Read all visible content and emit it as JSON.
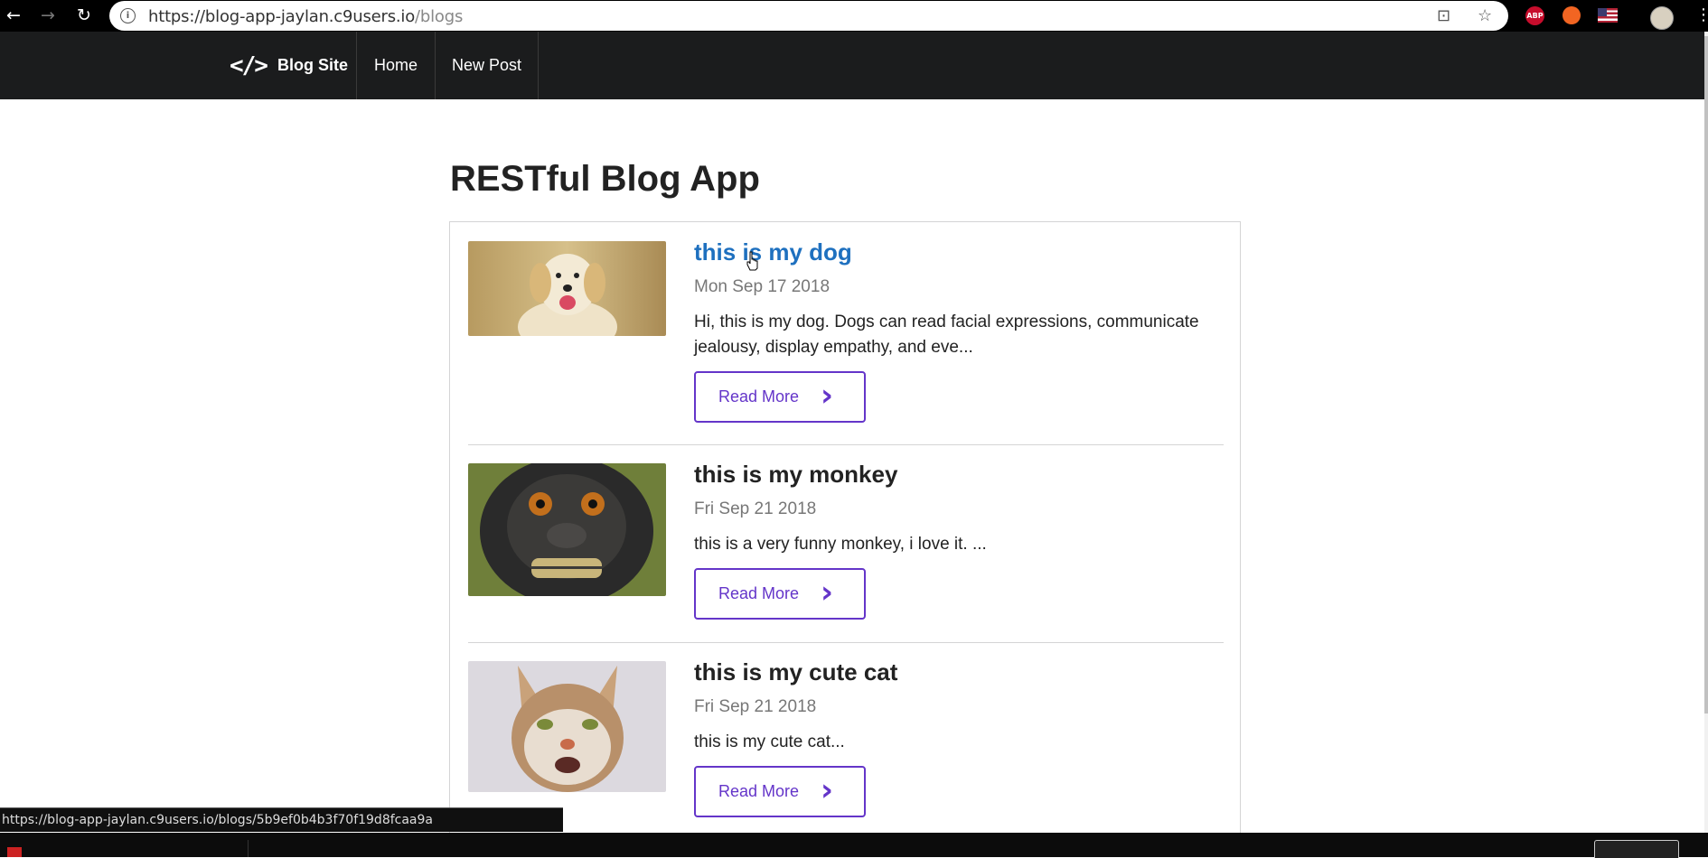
{
  "browser": {
    "url_host": "https://blog-app-jaylan.c9users.io",
    "url_path": "/blogs",
    "status_url": "https://blog-app-jaylan.c9users.io/blogs/5b9ef0b4b3f70f19d8fcaa9a",
    "extensions": {
      "abp_label": "ABP"
    }
  },
  "nav": {
    "brand": "Blog Site",
    "items": [
      {
        "label": "Home"
      },
      {
        "label": "New Post"
      }
    ]
  },
  "page": {
    "title": "RESTful Blog App"
  },
  "posts": [
    {
      "title": "this is my dog",
      "date": "Mon Sep 17 2018",
      "excerpt": "Hi, this is my dog. Dogs can read facial expressions, communicate jealousy, display empathy, and eve...",
      "button": "Read More",
      "image": "dog-photo"
    },
    {
      "title": "this is my monkey",
      "date": "Fri Sep 21 2018",
      "excerpt": "this is a very funny monkey, i love it. ...",
      "button": "Read More",
      "image": "monkey-photo"
    },
    {
      "title": "this is my cute cat",
      "date": "Fri Sep 21 2018",
      "excerpt": "this is my cute cat...",
      "button": "Read More",
      "image": "cat-photo"
    }
  ],
  "colors": {
    "navbar": "#1b1c1d",
    "link_active": "#1e70bf",
    "button_accent": "#6435c9"
  }
}
